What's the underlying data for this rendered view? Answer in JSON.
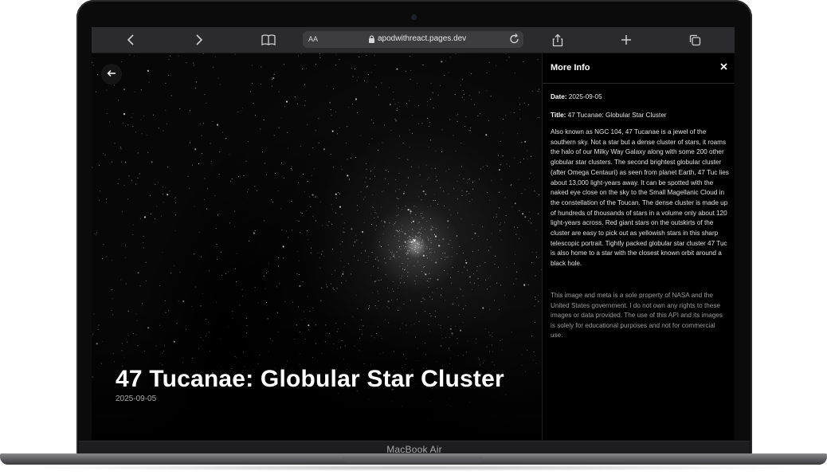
{
  "device": {
    "label": "MacBook Air"
  },
  "browser": {
    "text_size_label": "AA",
    "url": "apodwithreact.pages.dev"
  },
  "hero": {
    "title": "47 Tucanae: Globular Star Cluster",
    "date": "2025-09-05"
  },
  "panel": {
    "heading": "More Info",
    "date_label": "Date:",
    "date_value": "2025-09-05",
    "title_label": "Title:",
    "title_value": "47 Tucanae: Globular Star Cluster",
    "description": "Also known as NGC 104, 47 Tucanae is a jewel of the southern sky. Not a star but a dense cluster of stars, it roams the halo of our Milky Way Galaxy along with some 200 other globular star clusters. The second brightest globular cluster (after Omega Centauri) as seen from planet Earth, 47 Tuc lies about 13,000 light-years away. It can be spotted with the naked eye close on the sky to the Small Magellanic Cloud in the constellation of the Toucan. The dense cluster is made up of hundreds of thousands of stars in a volume only about 120 light-years across. Red giant stars on the outskirts of the cluster are easy to pick out as yellowish stars in this sharp telescopic portrait. Tightly packed globular star cluster 47 Tuc is also home to a star with the closest known orbit around a black hole.",
    "disclaimer": "This image and meta is a sole property of NASA and the United States government. I do not own any rights to these images or data provided. The use of this API and its images is solely for educational purposes and not for commercial use."
  },
  "icons": {
    "back": "arrow-left-icon",
    "close": "close-icon",
    "nav_back": "chevron-left-icon",
    "nav_forward": "chevron-right-icon",
    "bookmarks": "book-icon",
    "lock": "lock-icon",
    "reload": "reload-icon",
    "share": "share-icon",
    "new_tab": "plus-icon",
    "tabs": "tabs-icon"
  },
  "colors": {
    "background": "#000000",
    "toolbar": "#2b2b2d",
    "text": "#ffffff",
    "muted": "#9a9a9a"
  }
}
